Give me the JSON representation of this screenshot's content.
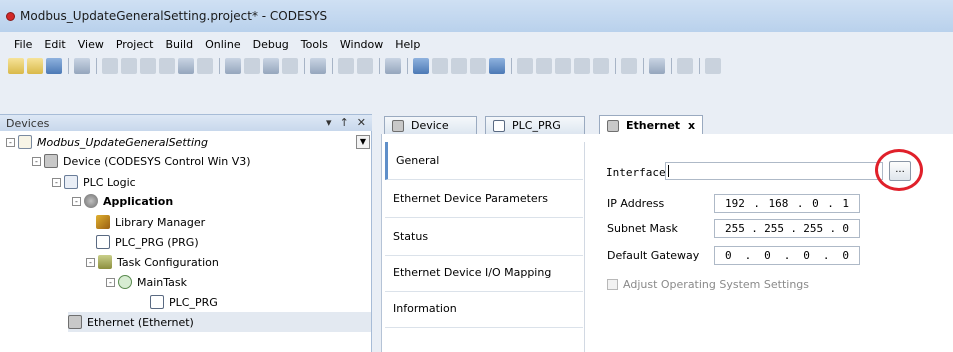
{
  "window": {
    "title": "Modbus_UpdateGeneralSetting.project* - CODESYS"
  },
  "menu": [
    "File",
    "Edit",
    "View",
    "Project",
    "Build",
    "Online",
    "Debug",
    "Tools",
    "Window",
    "Help"
  ],
  "devices_panel": {
    "title": "Devices",
    "pin": "↑",
    "close": "✕",
    "tree": [
      {
        "label": "Modbus_UpdateGeneralSetting",
        "icon": "project-icon"
      },
      {
        "label": "Device (CODESYS Control Win V3)",
        "icon": "device-icon"
      },
      {
        "label": "PLC Logic",
        "icon": "plc-logic-icon"
      },
      {
        "label": "Application",
        "icon": "application-icon"
      },
      {
        "label": "Library Manager",
        "icon": "library-icon"
      },
      {
        "label": "PLC_PRG (PRG)",
        "icon": "program-icon"
      },
      {
        "label": "Task Configuration",
        "icon": "task-config-icon"
      },
      {
        "label": "MainTask",
        "icon": "task-icon"
      },
      {
        "label": "PLC_PRG",
        "icon": "program-icon"
      },
      {
        "label": "Ethernet (Ethernet)",
        "icon": "device-icon"
      }
    ]
  },
  "tabs": [
    {
      "label": "Device"
    },
    {
      "label": "PLC_PRG"
    },
    {
      "label": "Ethernet",
      "close": "x"
    }
  ],
  "side_tabs": [
    "General",
    "Ethernet Device Parameters",
    "Status",
    "Ethernet Device I/O Mapping",
    "Information"
  ],
  "general": {
    "interface_label": "Interface:",
    "interface_value": "",
    "browse_label": "...",
    "ip_label": "IP Address",
    "ip": [
      "192",
      "168",
      "0",
      "1"
    ],
    "subnet_label": "Subnet Mask",
    "subnet": [
      "255",
      "255",
      "255",
      "0"
    ],
    "gateway_label": "Default Gateway",
    "gateway": [
      "0",
      "0",
      "0",
      "0"
    ],
    "dot": ".",
    "adjust_label": "Adjust Operating System Settings"
  },
  "colors": {
    "highlight_circle": "#e0202a",
    "active_tab_accent": "#5f8fc9"
  }
}
